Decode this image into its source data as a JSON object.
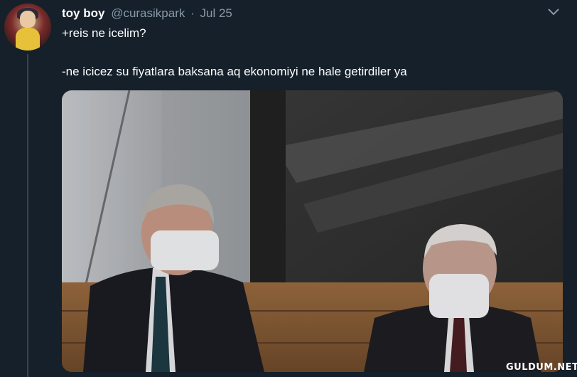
{
  "tweet": {
    "display_name": "toy boy",
    "handle": "@curasikpark",
    "separator": "·",
    "date": "Jul 25",
    "text_line_1": "+reis ne icelim?",
    "text_line_2": "-ne icicez su fiyatlara baksana aq ekonomiyi ne hale getirdiler ya"
  },
  "media": {
    "watermark": "GULDUM.NET"
  },
  "colors": {
    "background": "#15202b",
    "secondary_text": "#8899a6",
    "divider": "#38444d"
  },
  "icons": {
    "menu": "chevron-down-icon",
    "avatar": "avatar"
  }
}
